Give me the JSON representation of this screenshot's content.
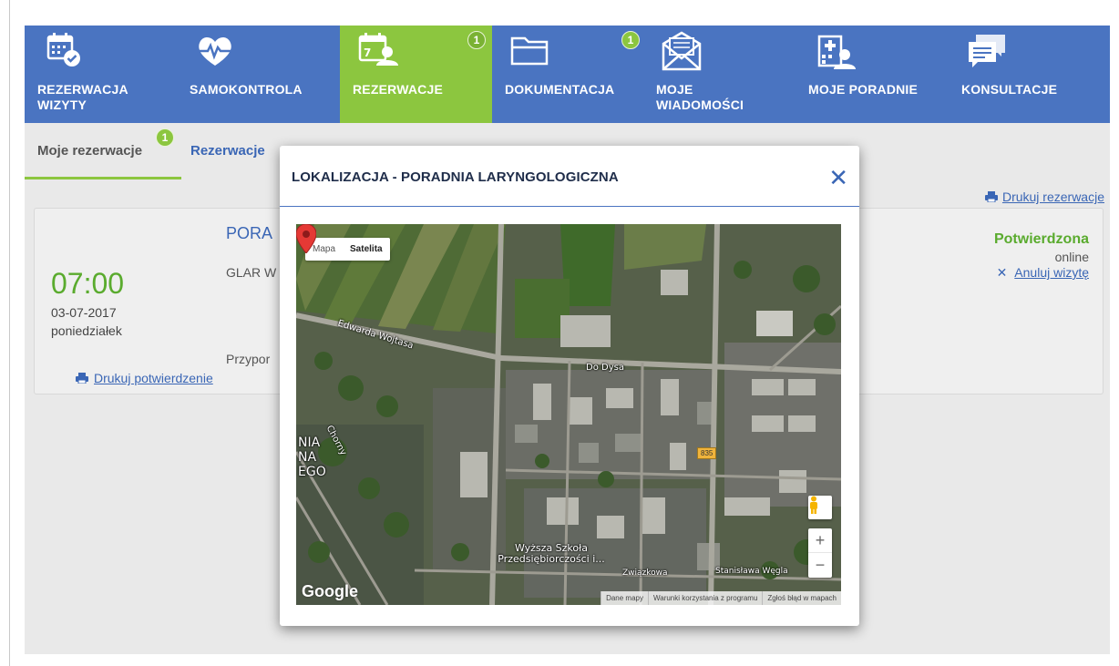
{
  "nav": {
    "items": [
      {
        "label": "REZERWACJA WIZYTY",
        "icon": "calendar-check-icon",
        "badge": null
      },
      {
        "label": "SAMOKONTROLA",
        "icon": "heart-pulse-icon",
        "badge": null
      },
      {
        "label": "REZERWACJE",
        "icon": "calendar-user-icon",
        "badge": "1"
      },
      {
        "label": "DOKUMENTACJA",
        "icon": "folder-icon",
        "badge": "1"
      },
      {
        "label": "MOJE WIADOMOŚCI",
        "icon": "envelope-icon",
        "badge": null
      },
      {
        "label": "MOJE PORADNIE",
        "icon": "hospital-user-icon",
        "badge": null
      },
      {
        "label": "KONSULTACJE",
        "icon": "chat-icon",
        "badge": null
      }
    ],
    "active_color": "#8cc63f",
    "bar_color": "#4a74c1"
  },
  "subtabs": {
    "my_reservations": "Moje rezerwacje",
    "my_reservations_badge": "1",
    "reservations_other": "Rezerwacje"
  },
  "page": {
    "print_reservations": "Drukuj rezerwacje"
  },
  "reservation": {
    "time": "07:00",
    "date": "03-07-2017",
    "weekday": "poniedziałek",
    "clinic": "PORA",
    "doctor": "GLAR W",
    "reminder": "Przypor",
    "print_confirmation": "Drukuj potwierdzenie",
    "status": "Potwierdzona",
    "channel": "online",
    "cancel": "Anuluj wizytę",
    "status_color": "#5aab2e"
  },
  "modal": {
    "title": "LOKALIZACJA - PORADNIA LARYNGOLOGICZNA",
    "close": "✕",
    "map": {
      "type_map": "Mapa",
      "type_satellite": "Satelita",
      "selected_type": "Satelita",
      "street_1": "Edwarda Wojtasa",
      "street_2": "Do Dysa",
      "street_3": "Chorny",
      "street_4": "Związkowa",
      "street_5": "Stanisława Węgla",
      "poi": "Wyższa Szkoła Przedsiębiorczości i...",
      "road_number": "835",
      "cut_label": "NIA NA EGO",
      "logo": "Google",
      "zoom_in": "+",
      "zoom_out": "−",
      "footer": [
        "Dane mapy",
        "Warunki korzystania z programu",
        "Zgłoś błąd w mapach"
      ]
    }
  }
}
